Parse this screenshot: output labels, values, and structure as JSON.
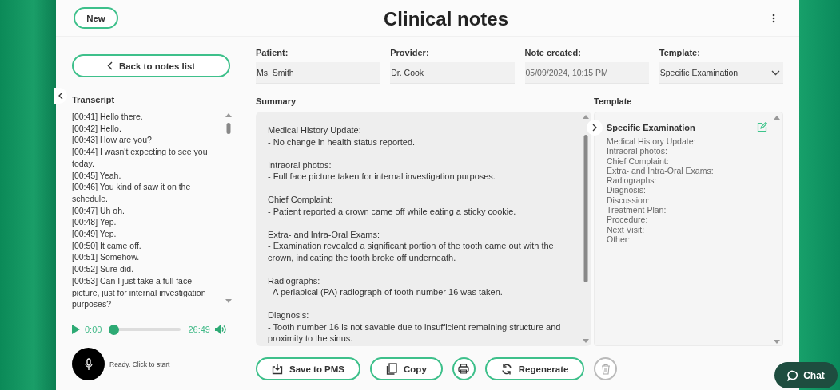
{
  "header": {
    "new_button": "New",
    "title": "Clinical notes"
  },
  "back_button": "Back to notes list",
  "transcript": {
    "label": "Transcript",
    "lines": [
      "[00:41] Hello there.",
      "[00:42] Hello.",
      "[00:43] How are you?",
      "[00:44] I wasn't expecting to see you today.",
      "[00:45] Yeah.",
      "[00:46] You kind of saw it on the schedule.",
      "[00:47] Uh oh.",
      "[00:48] Yep.",
      "[00:49] Yep.",
      "[00:50] It came off.",
      "[00:51] Somehow.",
      "[00:52] Sure did.",
      "[00:53] Can I just take a full face picture, just for internal investigation purposes?"
    ]
  },
  "player": {
    "current_time": "0:00",
    "duration": "26:49",
    "level": 0
  },
  "recorder": {
    "status": "Ready. Click to start"
  },
  "fields": [
    {
      "label": "Patient:",
      "value": "Ms. Smith",
      "kind": "text"
    },
    {
      "label": "Provider:",
      "value": "Dr. Cook",
      "kind": "text"
    },
    {
      "label": "Note created:",
      "value": "05/09/2024, 10:15 PM",
      "kind": "text"
    },
    {
      "label": "Template:",
      "value": "Specific Examination",
      "kind": "select"
    }
  ],
  "summary": {
    "label": "Summary",
    "sections": [
      {
        "heading": "Medical History Update:",
        "text": "- No change in health status reported."
      },
      {
        "heading": "Intraoral photos:",
        "text": "- Full face picture taken for internal investigation purposes."
      },
      {
        "heading": "Chief Complaint:",
        "text": "- Patient reported a crown came off while eating a sticky cookie."
      },
      {
        "heading": "Extra- and Intra-Oral Exams:",
        "text": "- Examination revealed a significant portion of the tooth came out with the crown, indicating the tooth broke off underneath."
      },
      {
        "heading": "Radiographs:",
        "text": "- A periapical (PA) radiograph of tooth number 16 was taken."
      },
      {
        "heading": "Diagnosis:",
        "text": "- Tooth number 16 is not savable due to insufficient remaining structure and proximity to the sinus."
      }
    ]
  },
  "template": {
    "label": "Template",
    "title": "Specific Examination",
    "items": [
      "Medical History Update:",
      "Intraoral photos:",
      "Chief Complaint:",
      "Extra- and Intra-Oral Exams:",
      "Radiographs:",
      "Diagnosis:",
      "Discussion:",
      "Treatment Plan:",
      "Procedure:",
      "Next Visit:",
      "Other:"
    ]
  },
  "actions": [
    {
      "kind": "save",
      "label": "Save to PMS",
      "disabled": false
    },
    {
      "kind": "copy",
      "label": "Copy",
      "disabled": false
    },
    {
      "kind": "print",
      "disabled": false
    },
    {
      "kind": "regenerate",
      "label": "Regenerate",
      "disabled": false
    },
    {
      "kind": "delete",
      "disabled": true
    }
  ],
  "chat_button": "Chat"
}
